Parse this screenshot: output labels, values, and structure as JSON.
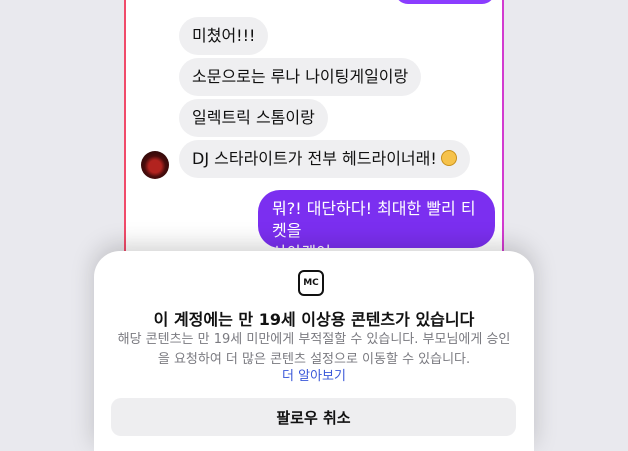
{
  "chat": {
    "received": [
      {
        "text": "미쳤어!!!"
      },
      {
        "text": "소문으로는 루나 나이팅게일이랑"
      },
      {
        "text": "일렉트릭 스톰이랑"
      },
      {
        "text": "DJ 스타라이트가 전부 헤드라이너래!",
        "emoji": "star-struck-emoji"
      }
    ],
    "sent": {
      "line1": "뭐?! 대단하다! 최대한 빨리 티켓을",
      "line2": "사야겠어."
    }
  },
  "sheet": {
    "icon_label": "MC",
    "title": "이 계정에는 만 19세 이상용 콘텐츠가 있습니다",
    "body_line1": "해당 콘텐츠는 만 19세 미만에게 부적절할 수 있습니다. 부모님에게 승인",
    "body_line2": "을 요청하여 더 많은 콘텐츠 설정으로 이동할 수 있습니다.",
    "learn_more": "더 알아보기",
    "button_label": "팔로우 취소"
  },
  "colors": {
    "sent_bubble": "#7b2ff0",
    "received_bubble": "#efeff1",
    "link": "#3b58d9"
  }
}
